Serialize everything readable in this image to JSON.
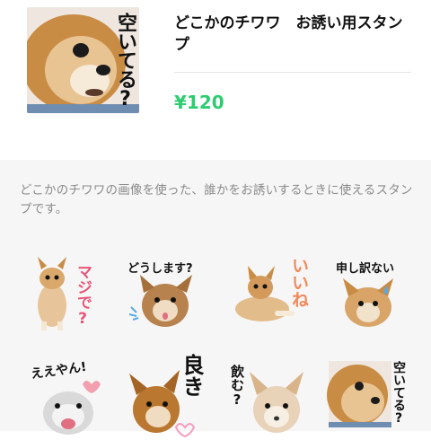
{
  "product": {
    "title": "どこかのチワワ　お誘い用スタンプ",
    "price": "¥120",
    "main_sticker_text": "空いてる?"
  },
  "description": "どこかのチワワの画像を使った、誰かをお誘いするときに使えるスタンプです。",
  "stickers": [
    {
      "text": "マジで?",
      "text_color": "#e8557a"
    },
    {
      "text": "どうします?",
      "text_color": "#111111"
    },
    {
      "text": "いいね",
      "text_color": "#f08a5d"
    },
    {
      "text": "申し訳ない",
      "text_color": "#111111"
    },
    {
      "text": "ええやん!",
      "text_color": "#111111"
    },
    {
      "text": "良き",
      "text_color": "#111111"
    },
    {
      "text": "飲む?",
      "text_color": "#111111"
    },
    {
      "text": "空いてる?",
      "text_color": "#111111"
    }
  ],
  "colors": {
    "price": "#2ecc71",
    "background": "#f6f6f6"
  }
}
